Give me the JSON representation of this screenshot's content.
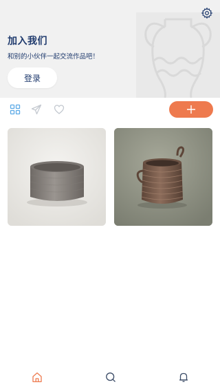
{
  "header": {
    "title": "加入我们",
    "subtitle": "和别的小伙伴一起交流作品吧！",
    "login_label": "登录",
    "settings_icon": "gear-icon",
    "decoration": "vase-outline"
  },
  "toolbar": {
    "tabs": [
      {
        "icon": "grid-icon",
        "active": true
      },
      {
        "icon": "send-icon",
        "active": false
      },
      {
        "icon": "heart-icon",
        "active": false
      }
    ],
    "add_icon": "plus-icon"
  },
  "works": [
    {
      "subject": "grey clay cylinder pot"
    },
    {
      "subject": "brown coiled basket pot with handles"
    }
  ],
  "bottom_nav": [
    {
      "icon": "home-icon",
      "active": true
    },
    {
      "icon": "search-icon",
      "active": false
    },
    {
      "icon": "bell-icon",
      "active": false
    }
  ],
  "colors": {
    "accent": "#ee7a4e",
    "title": "#1f3a6d",
    "tab_active": "#5aa9e6",
    "icon_inactive": "#c4c9d0",
    "header_bg": "#f1f1f1"
  }
}
